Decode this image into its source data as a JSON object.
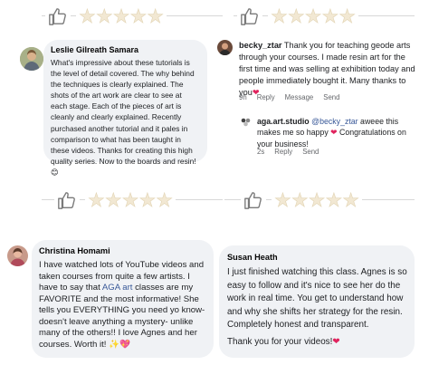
{
  "ratings": [
    {
      "stars": "★★★★★",
      "score": 5
    },
    {
      "stars": "★★★★★",
      "score": 5
    },
    {
      "stars": "★★★★★",
      "score": 5
    },
    {
      "stars": "★★★★★",
      "score": 5
    }
  ],
  "review1": {
    "author": "Leslie Gilreath Samara",
    "text": "What's impressive about these tutorials is the level of detail covered.  The why behind the techniques is clearly explained. The shots of the art work are clear to see at each stage. Each of the pieces of art is cleanly and clearly explained.  Recently purchased another tutorial and it pales in comparison to what has been taught in these videos.  Thanks for creating this high quality series.  Now to the boards and resin! ",
    "emoji": "😊"
  },
  "review2": {
    "author": "becky_ztar",
    "text": " Thank you for teaching geode arts through your courses. I made resin art for the first time and was selling at exhibition today and people immediately bought it. Many thanks to you",
    "emoji": "❤",
    "actions": {
      "time": "9h",
      "reply": "Reply",
      "message": "Message",
      "send": "Send"
    },
    "reply": {
      "author": "aga.art.studio",
      "mention": "@becky_ztar",
      "text_before": " aweee this makes me so happy ",
      "emoji": "❤",
      "text_after": "  Congratulations on your business!",
      "actions": {
        "time": "2s",
        "reply": "Reply",
        "send": "Send"
      }
    }
  },
  "review3": {
    "author": "Christina Homami",
    "text_before": "I have watched lots of YouTube videos and taken courses from quite a few artists. I have to say that ",
    "link": "AGA art",
    "text_after": " classes are my FAVORITE and the most informative! She tells you EVERYTHING you need yo know- doesn't leave anything a mystery- unlike many of the others!! I love Agnes and her courses.  Worth it! ",
    "emoji": "✨💖"
  },
  "review4": {
    "author": "Susan Heath",
    "text": "I just finished watching this class. Agnes is so easy to follow and it's nice to see her do the work in real time. You get to understand how and why she shifts her strategy for the resin. Completely honest and transparent.",
    "thanks": "Thank you for your videos!",
    "emoji": "❤"
  },
  "colors": {
    "bubble_bg": "#f0f2f5",
    "star_fill": "#f2e8d3",
    "meta_text": "#65676b",
    "link": "#385898",
    "heart": "#e0245e"
  }
}
